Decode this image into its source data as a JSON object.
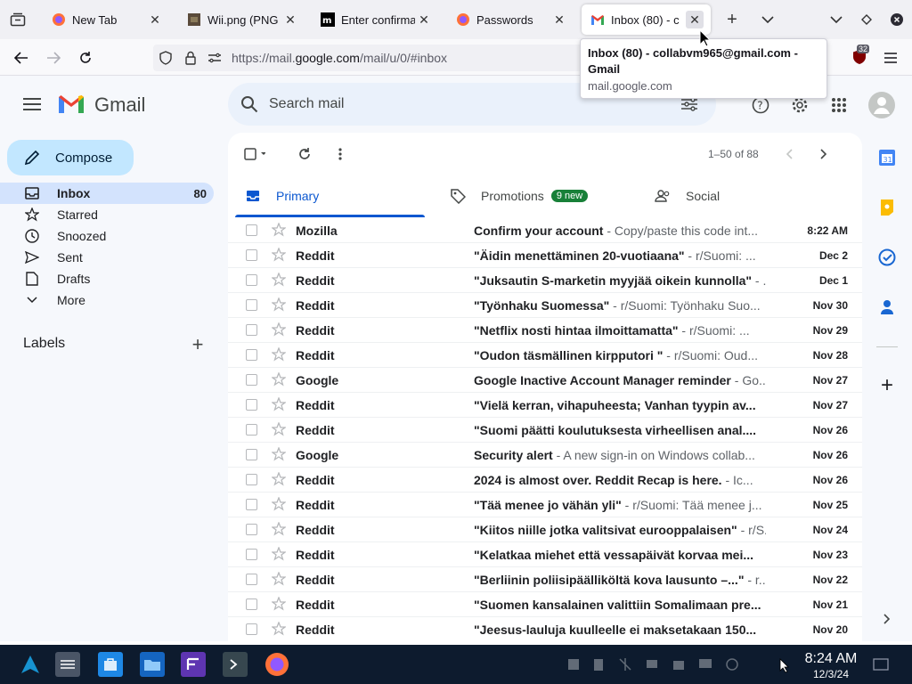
{
  "browser": {
    "tabs": [
      {
        "title": "New Tab",
        "active": false
      },
      {
        "title": "Wii.png (PNG I",
        "active": false
      },
      {
        "title": "Enter confirma",
        "active": false
      },
      {
        "title": "Passwords",
        "active": false
      },
      {
        "title": "Inbox (80) - c",
        "active": true
      }
    ],
    "url_prefix": "https://mail.",
    "url_domain": "google.com",
    "url_suffix": "/mail/u/0/#inbox",
    "extension_badge": "32",
    "tooltip": {
      "title": "Inbox (80) - collabvm965@gmail.com - Gmail",
      "url": "mail.google.com"
    }
  },
  "gmail": {
    "logo_text": "Gmail",
    "search_placeholder": "Search mail",
    "compose_label": "Compose",
    "nav": [
      {
        "label": "Inbox",
        "count": "80",
        "icon": "inbox-icon",
        "active": true
      },
      {
        "label": "Starred",
        "count": "",
        "icon": "star-icon",
        "active": false
      },
      {
        "label": "Snoozed",
        "count": "",
        "icon": "clock-icon",
        "active": false
      },
      {
        "label": "Sent",
        "count": "",
        "icon": "send-icon",
        "active": false
      },
      {
        "label": "Drafts",
        "count": "",
        "icon": "draft-icon",
        "active": false
      },
      {
        "label": "More",
        "count": "",
        "icon": "chevron-down-icon",
        "active": false
      }
    ],
    "labels_heading": "Labels",
    "pagination": "1–50 of 88",
    "categories": [
      {
        "label": "Primary",
        "badge": "",
        "icon": "inbox-tab-icon"
      },
      {
        "label": "Promotions",
        "badge": "9 new",
        "icon": "tag-icon"
      },
      {
        "label": "Social",
        "badge": "",
        "icon": "people-icon"
      }
    ],
    "emails": [
      {
        "sender": "Mozilla",
        "subject": "Confirm your account",
        "snippet": " - Copy/paste this code int...",
        "date": "8:22 AM"
      },
      {
        "sender": "Reddit",
        "subject": "\"Äidin menettäminen 20-vuotiaana\"",
        "snippet": " - r/Suomi: ...",
        "date": "Dec 2"
      },
      {
        "sender": "Reddit",
        "subject": "\"Juksautin S-marketin myyjää oikein kunnolla\"",
        "snippet": " - ...",
        "date": "Dec 1"
      },
      {
        "sender": "Reddit",
        "subject": "\"Työnhaku Suomessa\"",
        "snippet": " - r/Suomi: Työnhaku Suo...",
        "date": "Nov 30"
      },
      {
        "sender": "Reddit",
        "subject": "\"Netflix nosti hintaa ilmoittamatta\"",
        "snippet": " - r/Suomi: ...",
        "date": "Nov 29"
      },
      {
        "sender": "Reddit",
        "subject": "\"Oudon täsmällinen kirpputori \"",
        "snippet": " - r/Suomi: Oud...",
        "date": "Nov 28"
      },
      {
        "sender": "Google",
        "subject": "Google Inactive Account Manager reminder",
        "snippet": " - Go...",
        "date": "Nov 27"
      },
      {
        "sender": "Reddit",
        "subject": "\"Vielä kerran, vihapuheesta; Vanhan tyypin av...",
        "snippet": "",
        "date": "Nov 27"
      },
      {
        "sender": "Reddit",
        "subject": "\"Suomi päätti koulutuksesta virheellisen anal....",
        "snippet": "",
        "date": "Nov 26"
      },
      {
        "sender": "Google",
        "subject": "Security alert",
        "snippet": " - A new sign-in on Windows collab...",
        "date": "Nov 26"
      },
      {
        "sender": "Reddit",
        "subject": "2024 is almost over. Reddit Recap is here.",
        "snippet": " - Ic...",
        "date": "Nov 26"
      },
      {
        "sender": "Reddit",
        "subject": "\"Tää menee jo vähän yli\"",
        "snippet": " - r/Suomi: Tää menee j...",
        "date": "Nov 25"
      },
      {
        "sender": "Reddit",
        "subject": "\"Kiitos niille jotka valitsivat eurooppalaisen\"",
        "snippet": " - r/S...",
        "date": "Nov 24"
      },
      {
        "sender": "Reddit",
        "subject": "\"Kelatkaa miehet että vessapäivät korvaa mei...",
        "snippet": "",
        "date": "Nov 23"
      },
      {
        "sender": "Reddit",
        "subject": "\"Berliinin poliisipäälliköltä kova lausunto –...\"",
        "snippet": " - r...",
        "date": "Nov 22"
      },
      {
        "sender": "Reddit",
        "subject": "\"Suomen kansalainen valittiin Somalimaan pre...",
        "snippet": "",
        "date": "Nov 21"
      },
      {
        "sender": "Reddit",
        "subject": "\"Jeesus-lauluja kuulleelle ei maksetakaan 150...",
        "snippet": "",
        "date": "Nov 20"
      }
    ]
  },
  "taskbar": {
    "time": "8:24 AM",
    "date": "12/3/24"
  },
  "colors": {
    "accent": "#0b57d0",
    "compose_bg": "#c2e7ff",
    "selected_nav": "#d3e3fd",
    "promotions_badge": "#188038",
    "taskbar_bg": "#0d1b2e"
  }
}
